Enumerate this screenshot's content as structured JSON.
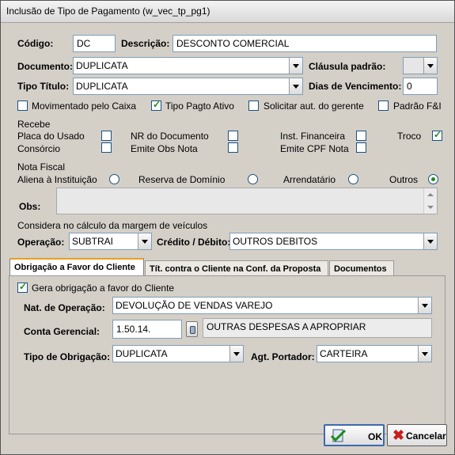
{
  "window": {
    "title": "Inclusão de Tipo de Pagamento (w_vec_tp_pg1)"
  },
  "form": {
    "codigo_label": "Código:",
    "codigo_value": "DC",
    "descricao_label": "Descrição:",
    "descricao_value": "DESCONTO COMERCIAL",
    "documento_label": "Documento:",
    "documento_value": "DUPLICATA",
    "clausula_label": "Cláusula padrão:",
    "clausula_value": "",
    "tipo_titulo_label": "Tipo Título:",
    "tipo_titulo_value": "DUPLICATA",
    "dias_label": "Dias de Vencimento:",
    "dias_value": "0",
    "checks": [
      {
        "label": "Movimentado pelo Caixa",
        "checked": false
      },
      {
        "label": "Tipo Pagto Ativo",
        "checked": true
      },
      {
        "label": "Solicitar aut. do gerente",
        "checked": false
      },
      {
        "label": "Padrão F&I",
        "checked": false
      }
    ]
  },
  "recebe": {
    "title": "Recebe",
    "items": [
      {
        "label": "Placa do Usado",
        "checked": false
      },
      {
        "label": "NR do Documento",
        "checked": false
      },
      {
        "label": "Inst. Financeira",
        "checked": false
      },
      {
        "label": "Troco",
        "checked": true
      },
      {
        "label": "Consórcio",
        "checked": false
      },
      {
        "label": "Emite Obs Nota",
        "checked": false
      },
      {
        "label": "Emite CPF Nota",
        "checked": false
      }
    ]
  },
  "nota_fiscal": {
    "title": "Nota Fiscal",
    "options": [
      {
        "label": "Aliena à Instituição",
        "selected": false
      },
      {
        "label": "Reserva de Domínio",
        "selected": false
      },
      {
        "label": "Arrendatário",
        "selected": false
      },
      {
        "label": "Outros",
        "selected": true
      }
    ],
    "obs_label": "Obs:",
    "obs_value": ""
  },
  "margem": {
    "title": "Considera no cálculo da margem de veículos",
    "operacao_label": "Operação:",
    "operacao_value": "SUBTRAI",
    "credito_label": "Crédito / Débito:",
    "credito_value": "OUTROS DEBITOS"
  },
  "tabs": [
    {
      "label": "Obrigação a Favor do Cliente",
      "active": true
    },
    {
      "label": "Tít. contra o Cliente na Conf. da Proposta",
      "active": false
    },
    {
      "label": "Documentos",
      "active": false
    }
  ],
  "obrigacao": {
    "gera_label": "Gera obrigação a favor do Cliente",
    "gera_checked": true,
    "nat_label": "Nat. de Operação:",
    "nat_value": "DEVOLUÇÃO DE VENDAS VAREJO",
    "conta_label": "Conta Gerencial:",
    "conta_value": "1.50.14.",
    "conta_desc": "OUTRAS DESPESAS A APROPRIAR",
    "tipo_label": "Tipo de Obrigação:",
    "tipo_value": "DUPLICATA",
    "agt_label": "Agt. Portador:",
    "agt_value": "CARTEIRA"
  },
  "buttons": {
    "ok_label": "OK",
    "cancel_label": "Cancelar"
  },
  "colors": {
    "accent_check": "#1e8a1e",
    "window_bg": "#d4d0c8",
    "tab_highlight": "#e6a020",
    "cancel_icon": "#c81e1e"
  },
  "icons": {
    "ok": "check-doc-icon",
    "cancel": "red-x-icon",
    "lookup": "lookup-icon"
  }
}
